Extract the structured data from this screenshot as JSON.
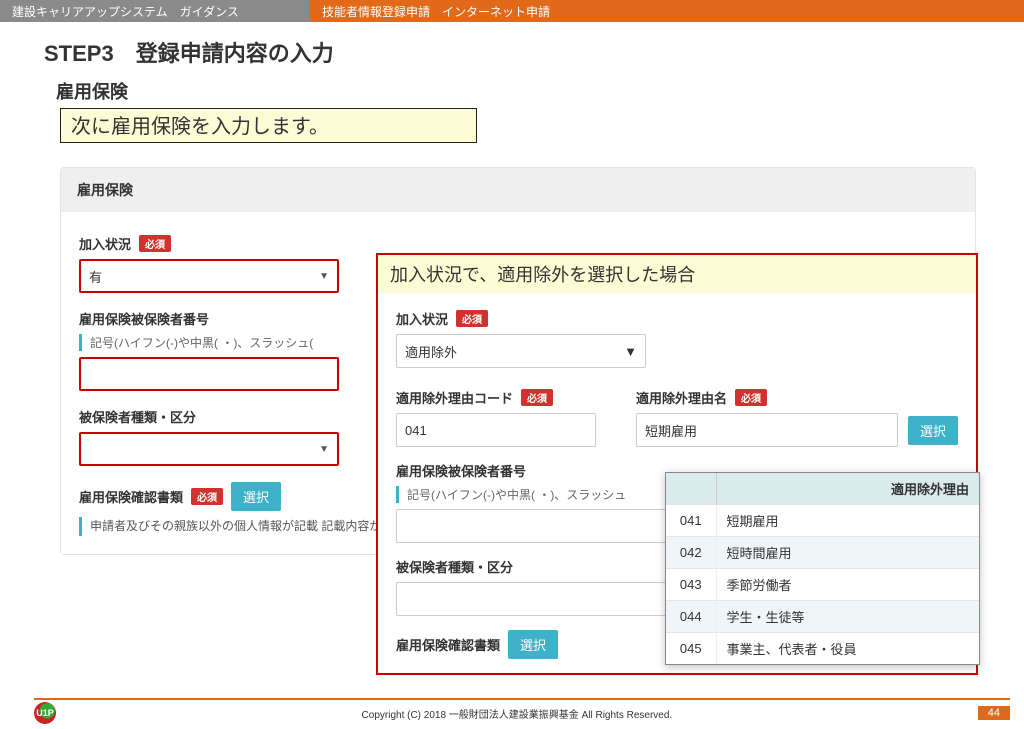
{
  "breadcrumb": {
    "left": "建設キャリアアップシステム　ガイダンス",
    "right": "技能者情報登録申請　インターネット申請"
  },
  "page_title": "STEP3　登録申請内容の入力",
  "section_title": "雇用保険",
  "callout_text": "次に雇用保険を入力します。",
  "panel": {
    "title": "雇用保険",
    "required_label": "必須",
    "select_button": "選択",
    "join_status_label": "加入状況",
    "join_status_value": "有",
    "insured_number_label": "雇用保険被保険者番号",
    "insured_number_hint": "記号(ハイフン(-)や中黒( ・)、スラッシュ(",
    "insured_type_label": "被保険者種類・区分",
    "confirm_doc_label": "雇用保険確認書類",
    "confirm_doc_note": "申請者及びその親族以外の個人情報が記載\n記載内容が鮮明に判読できる画像を添付し"
  },
  "overlay": {
    "title": "加入状況で、適用除外を選択した場合",
    "required_label": "必須",
    "select_button": "選択",
    "join_status_label": "加入状況",
    "join_status_value": "適用除外",
    "reason_code_label": "適用除外理由コード",
    "reason_code_value": "041",
    "reason_name_label": "適用除外理由名",
    "reason_name_value": "短期雇用",
    "insured_number_label": "雇用保険被保険者番号",
    "insured_number_hint": "記号(ハイフン(-)や中黒( ・)、スラッシュ",
    "insured_type_label": "被保険者種類・区分",
    "confirm_doc_label": "雇用保険確認書類"
  },
  "reason_table": {
    "header": "適用除外理由",
    "rows": [
      {
        "code": "041",
        "name": "短期雇用"
      },
      {
        "code": "042",
        "name": "短時間雇用"
      },
      {
        "code": "043",
        "name": "季節労働者"
      },
      {
        "code": "044",
        "name": "学生・生徒等"
      },
      {
        "code": "045",
        "name": "事業主、代表者・役員"
      }
    ]
  },
  "footer": {
    "copyright": "Copyright (C) 2018 一般財団法人建設業振興基金 All Rights Reserved.",
    "page_number": "44"
  }
}
